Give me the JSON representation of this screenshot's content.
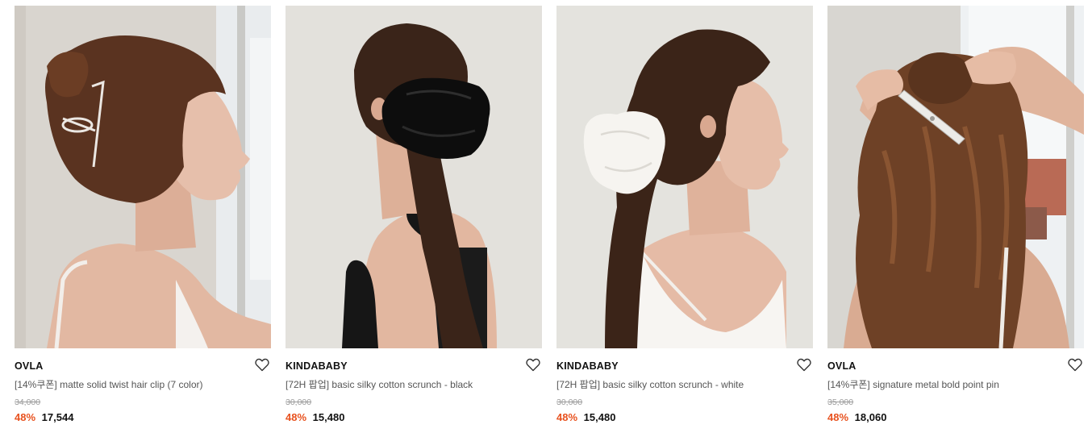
{
  "products": [
    {
      "brand": "OVLA",
      "name": "[14%쿠폰] matte solid twist hair clip (7 color)",
      "original_price": "34,000",
      "discount": "48%",
      "price": "17,544",
      "wishlist_icon": "heart-outline-icon",
      "image_desc": "woman-with-twist-hair-clip"
    },
    {
      "brand": "KINDABABY",
      "name": "[72H 팝업] basic silky cotton scrunch - black",
      "original_price": "30,000",
      "discount": "48%",
      "price": "15,480",
      "wishlist_icon": "heart-outline-icon",
      "image_desc": "woman-with-black-scrunchie"
    },
    {
      "brand": "KINDABABY",
      "name": "[72H 팝업] basic silky cotton scrunch - white",
      "original_price": "30,000",
      "discount": "48%",
      "price": "15,480",
      "wishlist_icon": "heart-outline-icon",
      "image_desc": "woman-with-white-scrunchie"
    },
    {
      "brand": "OVLA",
      "name": "[14%쿠폰] signature metal bold point pin",
      "original_price": "35,000",
      "discount": "48%",
      "price": "18,060",
      "wishlist_icon": "heart-outline-icon",
      "image_desc": "woman-with-metal-hair-pin"
    }
  ],
  "colors": {
    "discount": "#e8521f",
    "price": "#111111",
    "original_price": "#9a9a9a",
    "brand": "#111111",
    "name": "#555555"
  }
}
